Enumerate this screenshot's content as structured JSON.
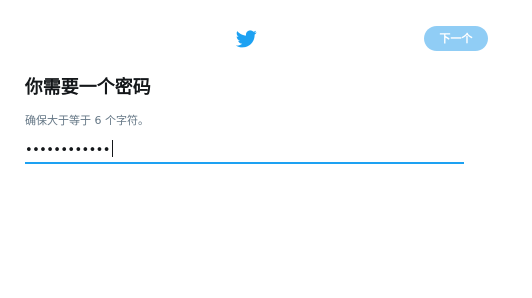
{
  "header": {
    "logo_icon": "twitter-bird-icon",
    "next_label": "下一个"
  },
  "main": {
    "title": "你需要一个密码",
    "hint": "确保大于等于 6 个字符。",
    "password": {
      "masked_value": "••••••••••••"
    }
  },
  "colors": {
    "accent": "#1da1f2",
    "button_disabled": "#90cdf5",
    "hint_text": "#657786",
    "title_text": "#14171a"
  }
}
